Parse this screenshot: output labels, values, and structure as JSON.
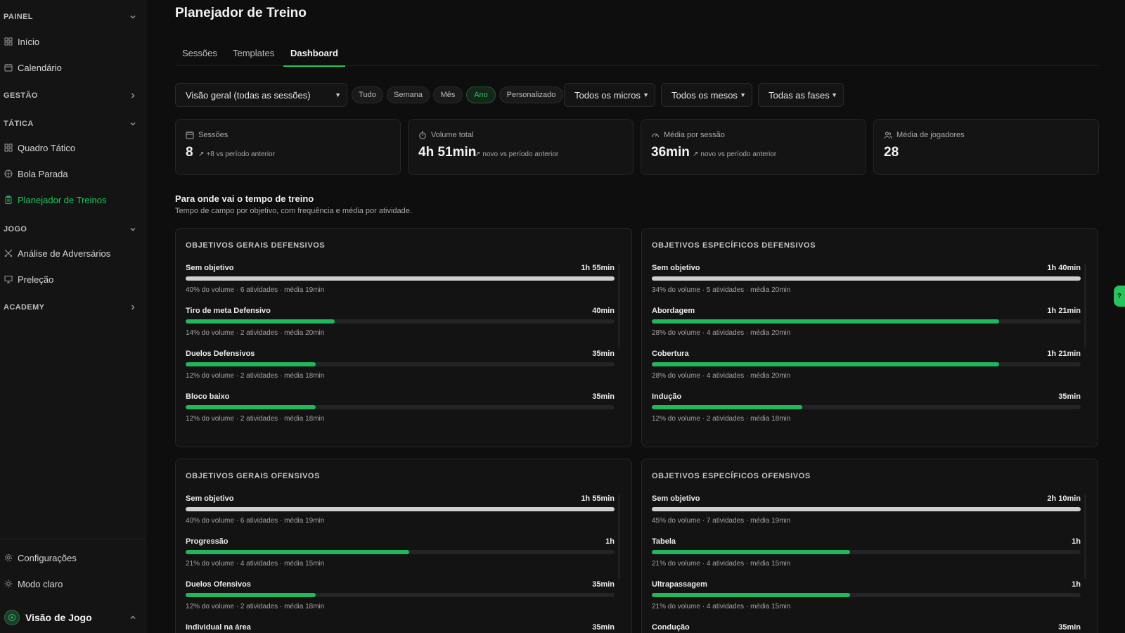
{
  "sidebar": {
    "sections": {
      "painel": "PAINEL",
      "gestao": "GESTÃO",
      "tatica": "TÁTICA",
      "jogo": "JOGO",
      "academy": "ACADEMY"
    },
    "items": {
      "inicio": "Início",
      "calendario": "Calendário",
      "quadro": "Quadro Tático",
      "bola": "Bola Parada",
      "planejador": "Planejador de Treinos",
      "analise": "Análise de Adversários",
      "prelecao": "Preleção",
      "config": "Configurações",
      "modo": "Modo claro"
    },
    "brand": "Visão de Jogo"
  },
  "page": {
    "title": "Planejador de Treino",
    "tabs": [
      "Sessões",
      "Templates",
      "Dashboard"
    ],
    "active_tab": "Dashboard"
  },
  "filters": {
    "view": "Visão geral (todas as sessões)",
    "periods": [
      "Tudo",
      "Semana",
      "Mês",
      "Ano",
      "Personalizado"
    ],
    "active_period": "Ano",
    "micros": "Todos os micros",
    "mesos": "Todos os mesos",
    "fases": "Todas as fases"
  },
  "stats": [
    {
      "label": "Sessões",
      "value": "8",
      "delta": "+8 vs período anterior",
      "icon": "calendar-icon"
    },
    {
      "label": "Volume total",
      "value": "4h 51min",
      "delta": "novo vs período anterior",
      "icon": "stopwatch-icon"
    },
    {
      "label": "Média por sessão",
      "value": "36min",
      "delta": "novo vs período anterior",
      "icon": "gauge-icon"
    },
    {
      "label": "Média de jogadores",
      "value": "28",
      "delta": "",
      "icon": "users-icon"
    }
  ],
  "section": {
    "title": "Para onde vai o tempo de treino",
    "subtitle": "Tempo de campo por objetivo, com frequência e média por atividade."
  },
  "panels": [
    {
      "title": "OBJETIVOS GERAIS DEFENSIVOS",
      "rows": [
        {
          "name": "Sem objetivo",
          "time": "1h 55min",
          "fill": 1.0,
          "neutral": true,
          "meta": "40% do volume · 6 atividades · média 19min"
        },
        {
          "name": "Tiro de meta Defensivo",
          "time": "40min",
          "fill": 0.348,
          "neutral": false,
          "meta": "14% do volume · 2 atividades · média 20min"
        },
        {
          "name": "Duelos Defensivos",
          "time": "35min",
          "fill": 0.304,
          "neutral": false,
          "meta": "12% do volume · 2 atividades · média 18min"
        },
        {
          "name": "Bloco baixo",
          "time": "35min",
          "fill": 0.304,
          "neutral": false,
          "meta": "12% do volume · 2 atividades · média 18min"
        }
      ]
    },
    {
      "title": "OBJETIVOS ESPECÍFICOS DEFENSIVOS",
      "rows": [
        {
          "name": "Sem objetivo",
          "time": "1h 40min",
          "fill": 1.0,
          "neutral": true,
          "meta": "34% do volume · 5 atividades · média 20min"
        },
        {
          "name": "Abordagem",
          "time": "1h 21min",
          "fill": 0.81,
          "neutral": false,
          "meta": "28% do volume · 4 atividades · média 20min"
        },
        {
          "name": "Cobertura",
          "time": "1h 21min",
          "fill": 0.81,
          "neutral": false,
          "meta": "28% do volume · 4 atividades · média 20min"
        },
        {
          "name": "Indução",
          "time": "35min",
          "fill": 0.35,
          "neutral": false,
          "meta": "12% do volume · 2 atividades · média 18min"
        }
      ]
    },
    {
      "title": "OBJETIVOS GERAIS OFENSIVOS",
      "rows": [
        {
          "name": "Sem objetivo",
          "time": "1h 55min",
          "fill": 1.0,
          "neutral": true,
          "meta": "40% do volume · 6 atividades · média 19min"
        },
        {
          "name": "Progressão",
          "time": "1h",
          "fill": 0.522,
          "neutral": false,
          "meta": "21% do volume · 4 atividades · média 15min"
        },
        {
          "name": "Duelos Ofensivos",
          "time": "35min",
          "fill": 0.304,
          "neutral": false,
          "meta": "12% do volume · 2 atividades · média 18min"
        },
        {
          "name": "Individual na área",
          "time": "35min",
          "fill": 0.304,
          "neutral": false,
          "meta": ""
        }
      ]
    },
    {
      "title": "OBJETIVOS ESPECÍFICOS OFENSIVOS",
      "rows": [
        {
          "name": "Sem objetivo",
          "time": "2h 10min",
          "fill": 1.0,
          "neutral": true,
          "meta": "45% do volume · 7 atividades · média 19min"
        },
        {
          "name": "Tabela",
          "time": "1h",
          "fill": 0.462,
          "neutral": false,
          "meta": "21% do volume · 4 atividades · média 15min"
        },
        {
          "name": "Ultrapassagem",
          "time": "1h",
          "fill": 0.462,
          "neutral": false,
          "meta": "21% do volume · 4 atividades · média 15min"
        },
        {
          "name": "Condução",
          "time": "35min",
          "fill": 0.269,
          "neutral": false,
          "meta": ""
        }
      ]
    }
  ],
  "colors": {
    "accent": "#22c55e",
    "bar_fill": "#1fb85a",
    "neutral_bar": "#cfcfcf",
    "bg": "#0e0e0f"
  }
}
